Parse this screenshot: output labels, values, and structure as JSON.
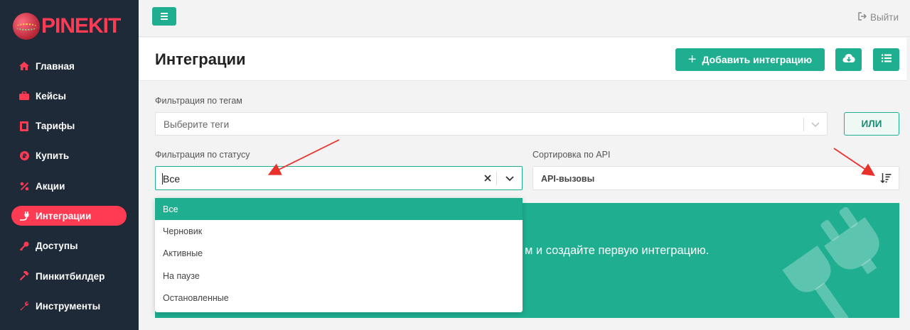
{
  "brand": {
    "logo_text": "PINEKIT",
    "accent": "#ff3b54",
    "primary": "#1fae90"
  },
  "sidebar": {
    "items": [
      {
        "label": "Главная",
        "icon": "home-icon",
        "active": false
      },
      {
        "label": "Кейсы",
        "icon": "briefcase-icon",
        "active": false
      },
      {
        "label": "Тарифы",
        "icon": "tariffs-icon",
        "active": false
      },
      {
        "label": "Купить",
        "icon": "ruble-icon",
        "active": false
      },
      {
        "label": "Акции",
        "icon": "percent-icon",
        "active": false
      },
      {
        "label": "Интеграции",
        "icon": "plug-icon",
        "active": true
      },
      {
        "label": "Доступы",
        "icon": "key-icon",
        "active": false
      },
      {
        "label": "Пинкитбилдер",
        "icon": "hammer-icon",
        "active": false
      },
      {
        "label": "Инструменты",
        "icon": "wrench-icon",
        "active": false
      }
    ]
  },
  "topbar": {
    "logout_label": "Выйти"
  },
  "header": {
    "title": "Интеграции",
    "add_button_label": "Добавить интеграцию"
  },
  "filters": {
    "tags": {
      "label": "Фильтрация по тегам",
      "placeholder": "Выберите теги",
      "or_button": "ИЛИ"
    },
    "status": {
      "label": "Фильтрация по статусу",
      "value": "Все",
      "options": [
        "Все",
        "Черновик",
        "Активные",
        "На паузе",
        "Остановленные"
      ],
      "selected_index": 0
    },
    "sort": {
      "label": "Сортировка по API",
      "value": "API-вызовы"
    }
  },
  "empty_state": {
    "text": "м и создайте первую интеграцию."
  }
}
